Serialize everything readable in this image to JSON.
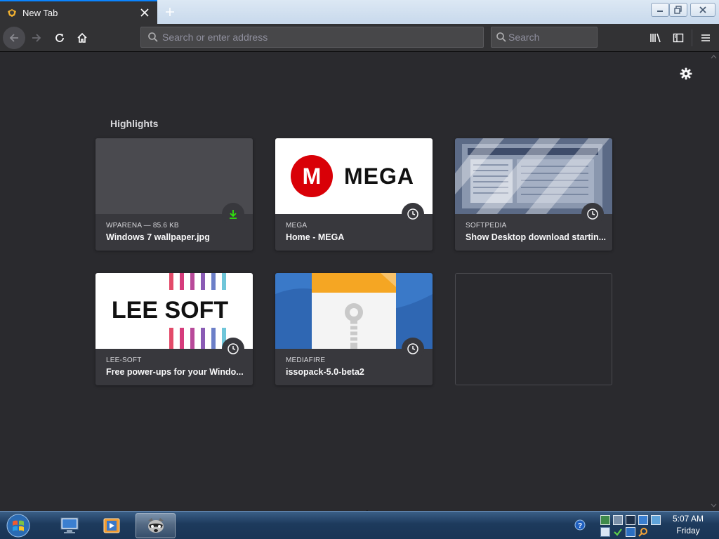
{
  "browser": {
    "tab": {
      "title": "New Tab"
    },
    "navbar": {
      "address_placeholder": "Search or enter address",
      "search_placeholder": "Search"
    }
  },
  "content": {
    "section_title": "Highlights",
    "cards": [
      {
        "source": "WPARENA — 85.6 KB",
        "title": "Windows 7 wallpaper.jpg",
        "badge": "download-icon"
      },
      {
        "source": "MEGA",
        "title": "Home - MEGA",
        "badge": "clock-icon",
        "logo_text": "MEGA",
        "logo_letter": "M"
      },
      {
        "source": "SOFTPEDIA",
        "title": "Show Desktop download startin...",
        "badge": "clock-icon"
      },
      {
        "source": "LEE-SOFT",
        "title": "Free power-ups for your Windo...",
        "badge": "clock-icon",
        "logo_text": "LEE SOFT"
      },
      {
        "source": "MEDIAFIRE",
        "title": "issopack-5.0-beta2",
        "badge": "clock-icon"
      }
    ]
  },
  "taskbar": {
    "clock": {
      "time": "5:07 AM",
      "day": "Friday"
    }
  },
  "colors": {
    "page_bg": "#2a2a2e",
    "toolbar_bg": "#323234",
    "card_bg": "#38383d",
    "accent": "#0a84ff",
    "download_green": "#30e60b",
    "mega_red": "#d90007"
  }
}
